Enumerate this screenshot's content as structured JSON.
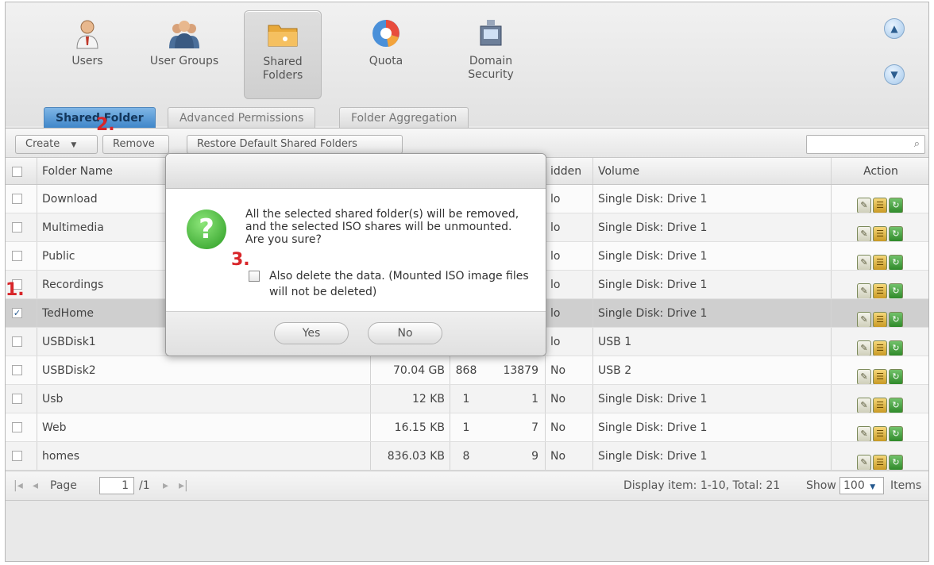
{
  "modules": [
    {
      "label": "Users",
      "icon": "user-icon"
    },
    {
      "label": "User Groups",
      "icon": "user-groups-icon"
    },
    {
      "label": "Shared Folders",
      "icon": "shared-folders-icon"
    },
    {
      "label": "Quota",
      "icon": "quota-icon"
    },
    {
      "label": "Domain Security",
      "icon": "domain-security-icon"
    }
  ],
  "tabs": [
    "Shared Folder",
    "Advanced Permissions",
    "Folder Aggregation"
  ],
  "toolbar": {
    "create": "Create",
    "remove": "Remove",
    "restore": "Restore Default Shared Folders"
  },
  "columns": {
    "name": "Folder Name",
    "hidden": "idden",
    "volume": "Volume",
    "action": "Action"
  },
  "rows": [
    {
      "name": "Download",
      "size": "",
      "folders": "",
      "files": "",
      "hidden": "lo",
      "volume": "Single Disk: Drive 1",
      "checked": false
    },
    {
      "name": "Multimedia",
      "size": "",
      "folders": "",
      "files": "",
      "hidden": "lo",
      "volume": "Single Disk: Drive 1",
      "checked": false
    },
    {
      "name": "Public",
      "size": "",
      "folders": "",
      "files": "",
      "hidden": "lo",
      "volume": "Single Disk: Drive 1",
      "checked": false
    },
    {
      "name": "Recordings",
      "size": "",
      "folders": "",
      "files": "",
      "hidden": "lo",
      "volume": "Single Disk: Drive 1",
      "checked": false
    },
    {
      "name": "TedHome",
      "size": "",
      "folders": "",
      "files": "",
      "hidden": "lo",
      "volume": "Single Disk: Drive 1",
      "checked": true
    },
    {
      "name": "USBDisk1",
      "size": "",
      "folders": "",
      "files": "",
      "hidden": "lo",
      "volume": "USB 1",
      "checked": false
    },
    {
      "name": "USBDisk2",
      "size": "70.04 GB",
      "folders": "868",
      "files": "13879",
      "hidden": "No",
      "volume": "USB 2",
      "checked": false
    },
    {
      "name": "Usb",
      "size": "12 KB",
      "folders": "1",
      "files": "1",
      "hidden": "No",
      "volume": "Single Disk: Drive 1",
      "checked": false
    },
    {
      "name": "Web",
      "size": "16.15 KB",
      "folders": "1",
      "files": "7",
      "hidden": "No",
      "volume": "Single Disk: Drive 1",
      "checked": false
    },
    {
      "name": "homes",
      "size": "836.03 KB",
      "folders": "8",
      "files": "9",
      "hidden": "No",
      "volume": "Single Disk: Drive 1",
      "checked": false
    }
  ],
  "pager": {
    "page_label": "Page",
    "page_value": "1",
    "page_total": "/1",
    "display": "Display item: 1-10, Total: 21",
    "show_label": "Show",
    "show_value": "100",
    "items_label": "Items"
  },
  "dialog": {
    "message": "All the selected shared folder(s) will be removed, and the selected ISO shares will be unmounted. Are you sure?",
    "checkbox_label": "Also delete the data. (Mounted ISO image files will not be deleted)",
    "yes": "Yes",
    "no": "No"
  },
  "annotations": [
    "1.",
    "2.",
    "3."
  ],
  "colors": {
    "accent": "#3f86c9",
    "annotation": "#d8262a",
    "confirm_icon": "#2a9b22"
  }
}
